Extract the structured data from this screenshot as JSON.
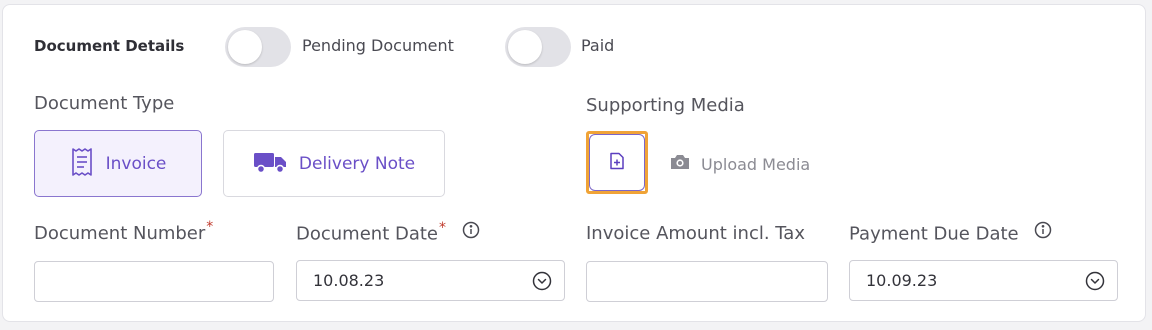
{
  "header": {
    "title": "Document Details",
    "toggles": [
      {
        "label": "Pending Document",
        "on": false
      },
      {
        "label": "Paid",
        "on": false
      }
    ]
  },
  "document_type": {
    "label": "Document Type",
    "options": [
      {
        "label": "Invoice",
        "selected": true,
        "icon": "receipt-icon"
      },
      {
        "label": "Delivery Note",
        "selected": false,
        "icon": "truck-icon"
      }
    ]
  },
  "supporting_media": {
    "label": "Supporting Media",
    "add_icon": "file-plus-icon",
    "upload_label": "Upload Media",
    "upload_icon": "camera-icon"
  },
  "fields": {
    "document_number": {
      "label": "Document Number",
      "required_mark": "*",
      "value": ""
    },
    "document_date": {
      "label": "Document Date",
      "required_mark": "*",
      "value": "10.08.23",
      "info_icon": "info-icon"
    },
    "invoice_amount": {
      "label": "Invoice Amount incl. Tax",
      "value": ""
    },
    "payment_due_date": {
      "label": "Payment Due Date",
      "value": "10.09.23",
      "info_icon": "info-icon"
    }
  },
  "colors": {
    "accent": "#6a4fc7",
    "selected_bg": "#f4f1fd",
    "focus_outline": "#f0a337",
    "required": "#c0392b"
  }
}
